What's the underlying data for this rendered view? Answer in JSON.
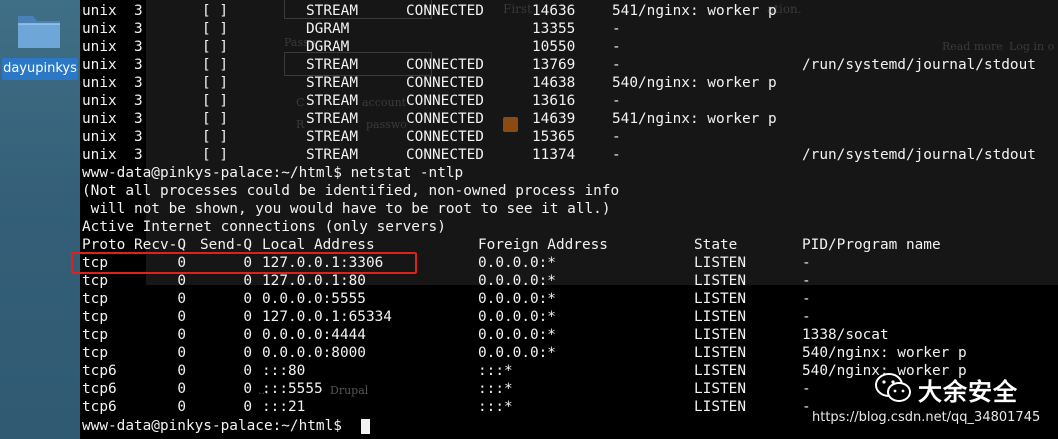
{
  "desktop": {
    "folder_label": "dayupinkys"
  },
  "background_page": {
    "fragments": [
      "First",
      "Passw",
      "Read more",
      "Log in o",
      "C",
      "account",
      "R",
      "passwo",
      "Drupal",
      "...",
      "ation."
    ]
  },
  "terminal": {
    "unix_rows": [
      {
        "proto": "unix",
        "refcnt": "3",
        "flags": "[ ]",
        "type": "STREAM",
        "state": "CONNECTED",
        "inode": "14636",
        "pid": "541/nginx: worker p",
        "path": ""
      },
      {
        "proto": "unix",
        "refcnt": "3",
        "flags": "[ ]",
        "type": "DGRAM",
        "state": "",
        "inode": "13355",
        "pid": "-",
        "path": ""
      },
      {
        "proto": "unix",
        "refcnt": "3",
        "flags": "[ ]",
        "type": "DGRAM",
        "state": "",
        "inode": "10550",
        "pid": "-",
        "path": ""
      },
      {
        "proto": "unix",
        "refcnt": "3",
        "flags": "[ ]",
        "type": "STREAM",
        "state": "CONNECTED",
        "inode": "13769",
        "pid": "-",
        "path": "/run/systemd/journal/stdout"
      },
      {
        "proto": "unix",
        "refcnt": "3",
        "flags": "[ ]",
        "type": "STREAM",
        "state": "CONNECTED",
        "inode": "14638",
        "pid": "540/nginx: worker p",
        "path": ""
      },
      {
        "proto": "unix",
        "refcnt": "3",
        "flags": "[ ]",
        "type": "STREAM",
        "state": "CONNECTED",
        "inode": "13616",
        "pid": "-",
        "path": ""
      },
      {
        "proto": "unix",
        "refcnt": "3",
        "flags": "[ ]",
        "type": "STREAM",
        "state": "CONNECTED",
        "inode": "14639",
        "pid": "541/nginx: worker p",
        "path": ""
      },
      {
        "proto": "unix",
        "refcnt": "3",
        "flags": "[ ]",
        "type": "STREAM",
        "state": "CONNECTED",
        "inode": "15365",
        "pid": "-",
        "path": ""
      },
      {
        "proto": "unix",
        "refcnt": "3",
        "flags": "[ ]",
        "type": "STREAM",
        "state": "CONNECTED",
        "inode": "11374",
        "pid": "-",
        "path": "/run/systemd/journal/stdout"
      }
    ],
    "command_line": "www-data@pinkys-palace:~/html$ netstat -ntlp",
    "notice_1": "(Not all processes could be identified, non-owned process info",
    "notice_2": " will not be shown, you would have to be root to see it all.)",
    "section_title": "Active Internet connections (only servers)",
    "header": {
      "proto": "Proto",
      "recvq": "Recv-Q",
      "sendq": "Send-Q",
      "local": "Local Address",
      "foreign": "Foreign Address",
      "state": "State",
      "pid": "PID/Program name"
    },
    "tcp_rows": [
      {
        "proto": "tcp",
        "recvq": "0",
        "sendq": "0",
        "local": "127.0.0.1:3306",
        "foreign": "0.0.0.0:*",
        "state": "LISTEN",
        "pid": "-"
      },
      {
        "proto": "tcp",
        "recvq": "0",
        "sendq": "0",
        "local": "127.0.0.1:80",
        "foreign": "0.0.0.0:*",
        "state": "LISTEN",
        "pid": "-"
      },
      {
        "proto": "tcp",
        "recvq": "0",
        "sendq": "0",
        "local": "0.0.0.0:5555",
        "foreign": "0.0.0.0:*",
        "state": "LISTEN",
        "pid": "-"
      },
      {
        "proto": "tcp",
        "recvq": "0",
        "sendq": "0",
        "local": "127.0.0.1:65334",
        "foreign": "0.0.0.0:*",
        "state": "LISTEN",
        "pid": "-"
      },
      {
        "proto": "tcp",
        "recvq": "0",
        "sendq": "0",
        "local": "0.0.0.0:4444",
        "foreign": "0.0.0.0:*",
        "state": "LISTEN",
        "pid": "1338/socat"
      },
      {
        "proto": "tcp",
        "recvq": "0",
        "sendq": "0",
        "local": "0.0.0.0:8000",
        "foreign": "0.0.0.0:*",
        "state": "LISTEN",
        "pid": "540/nginx: worker p"
      },
      {
        "proto": "tcp6",
        "recvq": "0",
        "sendq": "0",
        "local": ":::80",
        "foreign": ":::*",
        "state": "LISTEN",
        "pid": "540/nginx: worker p"
      },
      {
        "proto": "tcp6",
        "recvq": "0",
        "sendq": "0",
        "local": ":::5555",
        "foreign": ":::*",
        "state": "LISTEN",
        "pid": "-"
      },
      {
        "proto": "tcp6",
        "recvq": "0",
        "sendq": "0",
        "local": ":::21",
        "foreign": ":::*",
        "state": "LISTEN",
        "pid": "-"
      }
    ],
    "prompt": "www-data@pinkys-palace:~/html$",
    "text_color": "#f2f2f2",
    "highlight_color": "#e02020"
  },
  "watermark": {
    "brand": "大余安全",
    "url": "https://blog.csdn.net/qq_34801745",
    "icon": "wechat-icon"
  }
}
